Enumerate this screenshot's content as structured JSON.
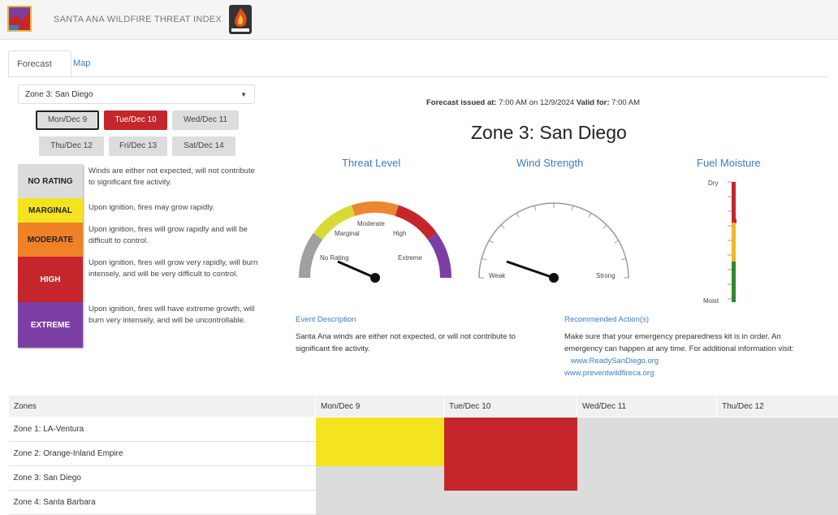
{
  "header": {
    "title": "SANTA ANA WILDFIRE THREAT INDEX"
  },
  "tabs": [
    {
      "label": "Forecast",
      "active": true
    },
    {
      "label": "Map",
      "active": false
    }
  ],
  "zone_select": {
    "value": "Zone 3: San Diego"
  },
  "days": [
    {
      "label": "Mon/Dec 9",
      "state": "outlined"
    },
    {
      "label": "Tue/Dec 10",
      "state": "active"
    },
    {
      "label": "Wed/Dec 11",
      "state": "default"
    },
    {
      "label": "Thu/Dec 12",
      "state": "default"
    },
    {
      "label": "Fri/Dec 13",
      "state": "default"
    },
    {
      "label": "Sat/Dec 14",
      "state": "default"
    }
  ],
  "legend": [
    {
      "label": "NO RATING",
      "color": "#dcdcdc",
      "text_color": "#222",
      "desc": "Winds are either not expected, will not contribute to significant fire activity."
    },
    {
      "label": "MARGINAL",
      "color": "#f4e41f",
      "text_color": "#222",
      "desc": "Upon ignition, fires may grow rapidly."
    },
    {
      "label": "MODERATE",
      "color": "#f08127",
      "text_color": "#222",
      "desc": "Upon ignition, fires will grow rapidly and will be difficult to control."
    },
    {
      "label": "HIGH",
      "color": "#c4262b",
      "text_color": "#ffffff",
      "desc": "Upon ignition, fires will grow very rapidly, will burn intensely, and will be very difficult to control."
    },
    {
      "label": "EXTREME",
      "color": "#7b3fa4",
      "text_color": "#ffffff",
      "desc": "Upon ignition, fires will have extreme growth, will burn very intensely, and will be uncontrollable."
    }
  ],
  "forecast": {
    "issued_label": "Forecast issued at:",
    "issued_time": "7:00 AM",
    "on_label": "on",
    "issued_date": "12/9/2024",
    "valid_label": "Valid for:",
    "valid_time": "7:00 AM",
    "zone_title": "Zone 3: San Diego"
  },
  "gauges": {
    "threat": {
      "title": "Threat Level",
      "labels": [
        "No Rating",
        "Marginal",
        "Moderate",
        "High",
        "Extreme"
      ],
      "colors": [
        "#a0a0a0",
        "#d9d935",
        "#ee8530",
        "#c4262b",
        "#7b3fa4"
      ]
    },
    "wind": {
      "title": "Wind Strength",
      "min_label": "Weak",
      "max_label": "Strong"
    },
    "fuel": {
      "title": "Fuel Moisture",
      "top_label": "Dry",
      "bottom_label": "Moist"
    }
  },
  "event": {
    "heading": "Event Description",
    "text": "Santa Ana winds are either not expected, or will not contribute to significant fire activity."
  },
  "actions": {
    "heading": "Recommended Action(s)",
    "text1": "Make sure that your emergency preparedness kit is in order. An emergency can happen at any time. For additional information visit:",
    "link1": "www.ReadySanDiego.org",
    "link2": "www.preventwildfireca.org"
  },
  "table": {
    "headers": [
      "Zones",
      "Mon/Dec 9",
      "Tue/Dec 10",
      "Wed/Dec 11",
      "Thu/Dec 12"
    ],
    "rows": [
      {
        "zone": "Zone 1: LA-Ventura",
        "cells": [
          "#f4e41f",
          "#c4262b",
          "#dcdcdc",
          "#dcdcdc"
        ]
      },
      {
        "zone": "Zone 2: Orange-Inland Empire",
        "cells": [
          "#f4e41f",
          "#c4262b",
          "#dcdcdc",
          "#dcdcdc"
        ]
      },
      {
        "zone": "Zone 3: San Diego",
        "cells": [
          "#dcdcdc",
          "#c4262b",
          "#dcdcdc",
          "#dcdcdc"
        ]
      },
      {
        "zone": "Zone 4: Santa Barbara",
        "cells": [
          "#dcdcdc",
          "#dcdcdc",
          "#dcdcdc",
          "#dcdcdc"
        ]
      }
    ]
  }
}
